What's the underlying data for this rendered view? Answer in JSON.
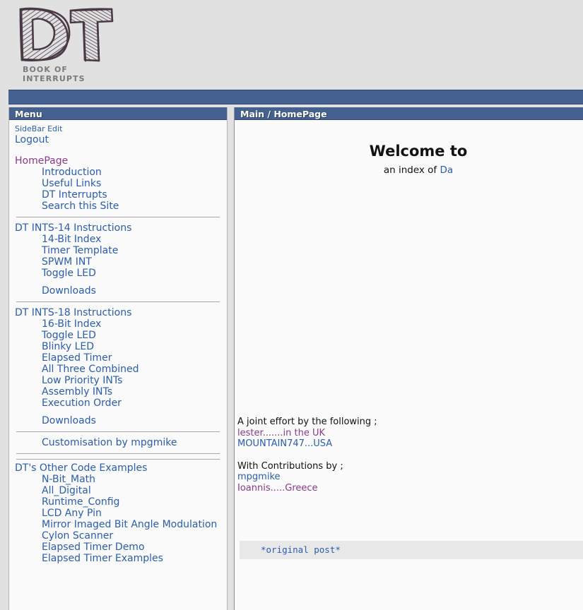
{
  "site": {
    "logo_letters": "DT",
    "logo_subtitle": "BOOK OF INTERRUPTS",
    "logo_icon": "hand-drawn-dt-logo"
  },
  "sidebar": {
    "title": "Menu",
    "groups": [
      {
        "items": [
          {
            "label": "SideBar Edit",
            "style": "small",
            "visited": false,
            "indent": false
          },
          {
            "label": "Logout",
            "style": "normal",
            "visited": false,
            "indent": false
          }
        ]
      },
      {
        "items": [
          {
            "label": "HomePage",
            "style": "normal",
            "visited": true,
            "indent": false
          },
          {
            "label": "Introduction",
            "style": "normal",
            "visited": false,
            "indent": true
          },
          {
            "label": "Useful Links",
            "style": "normal",
            "visited": false,
            "indent": true
          },
          {
            "label": "DT Interrupts",
            "style": "normal",
            "visited": false,
            "indent": true
          },
          {
            "label": "Search this Site",
            "style": "normal",
            "visited": false,
            "indent": true
          }
        ]
      },
      {
        "items": [
          {
            "label": "DT INTS-14 Instructions",
            "style": "normal",
            "visited": false,
            "indent": false
          },
          {
            "label": "14-Bit Index",
            "style": "normal",
            "visited": false,
            "indent": true
          },
          {
            "label": "Timer Template",
            "style": "normal",
            "visited": false,
            "indent": true
          },
          {
            "label": "SPWM INT",
            "style": "normal",
            "visited": false,
            "indent": true
          },
          {
            "label": "Toggle LED",
            "style": "normal",
            "visited": false,
            "indent": true
          },
          {
            "label": "Downloads",
            "style": "normal",
            "visited": false,
            "indent": true,
            "gap_before": true
          }
        ]
      },
      {
        "items": [
          {
            "label": "DT INTS-18 Instructions",
            "style": "normal",
            "visited": false,
            "indent": false
          },
          {
            "label": "16-Bit Index",
            "style": "normal",
            "visited": false,
            "indent": true
          },
          {
            "label": "Toggle LED",
            "style": "normal",
            "visited": false,
            "indent": true
          },
          {
            "label": "Blinky LED",
            "style": "normal",
            "visited": false,
            "indent": true
          },
          {
            "label": "Elapsed Timer",
            "style": "normal",
            "visited": false,
            "indent": true
          },
          {
            "label": "All Three Combined",
            "style": "normal",
            "visited": false,
            "indent": true
          },
          {
            "label": "Low Priority INTs",
            "style": "normal",
            "visited": false,
            "indent": true
          },
          {
            "label": "Assembly INTs",
            "style": "normal",
            "visited": false,
            "indent": true
          },
          {
            "label": "Execution Order",
            "style": "normal",
            "visited": false,
            "indent": true
          },
          {
            "label": "Downloads",
            "style": "normal",
            "visited": false,
            "indent": true,
            "gap_before": true
          }
        ]
      },
      {
        "items": [
          {
            "label": "Customisation by mpgmike",
            "style": "normal",
            "visited": false,
            "indent": true
          }
        ]
      },
      {
        "items": [
          {
            "label": "DT's Other Code Examples",
            "style": "normal",
            "visited": false,
            "indent": false
          },
          {
            "label": "N-Bit_Math",
            "style": "normal",
            "visited": false,
            "indent": true
          },
          {
            "label": "All_Digital",
            "style": "normal",
            "visited": false,
            "indent": true
          },
          {
            "label": "Runtime_Config",
            "style": "normal",
            "visited": false,
            "indent": true
          },
          {
            "label": "LCD Any Pin",
            "style": "normal",
            "visited": false,
            "indent": true
          },
          {
            "label": "Mirror Imaged Bit Angle Modulation",
            "style": "normal",
            "visited": false,
            "indent": true
          },
          {
            "label": "Cylon Scanner",
            "style": "normal",
            "visited": false,
            "indent": true
          },
          {
            "label": "Elapsed Timer Demo",
            "style": "normal",
            "visited": false,
            "indent": true
          },
          {
            "label": "Elapsed Timer Examples",
            "style": "normal",
            "visited": false,
            "indent": true
          }
        ]
      }
    ]
  },
  "main": {
    "title": "Main / HomePage",
    "welcome_heading": "Welcome to",
    "subtitle_prefix": "an index of ",
    "subtitle_link": "Da",
    "credits": {
      "joint_effort_label": "A joint effort by the following ;",
      "authors": [
        {
          "label": "lester.......in the UK",
          "visited": true
        },
        {
          "label": "MOUNTAIN747...USA",
          "visited": false
        }
      ],
      "contributions_label": "With Contributions by ;",
      "contributors": [
        {
          "label": "mpgmike",
          "visited": false
        },
        {
          "label": "Ioannis.....Greece",
          "visited": true
        }
      ]
    },
    "code_block": "*original post*"
  },
  "colors": {
    "bar_blue": "#45618f",
    "bar_border": "#2e4672",
    "link_blue": "#2a5db0",
    "link_visited": "#8b3a8b",
    "page_bg": "#e1e1e1",
    "panel_bg": "#fafafa",
    "code_bg": "#e8e8e8"
  }
}
